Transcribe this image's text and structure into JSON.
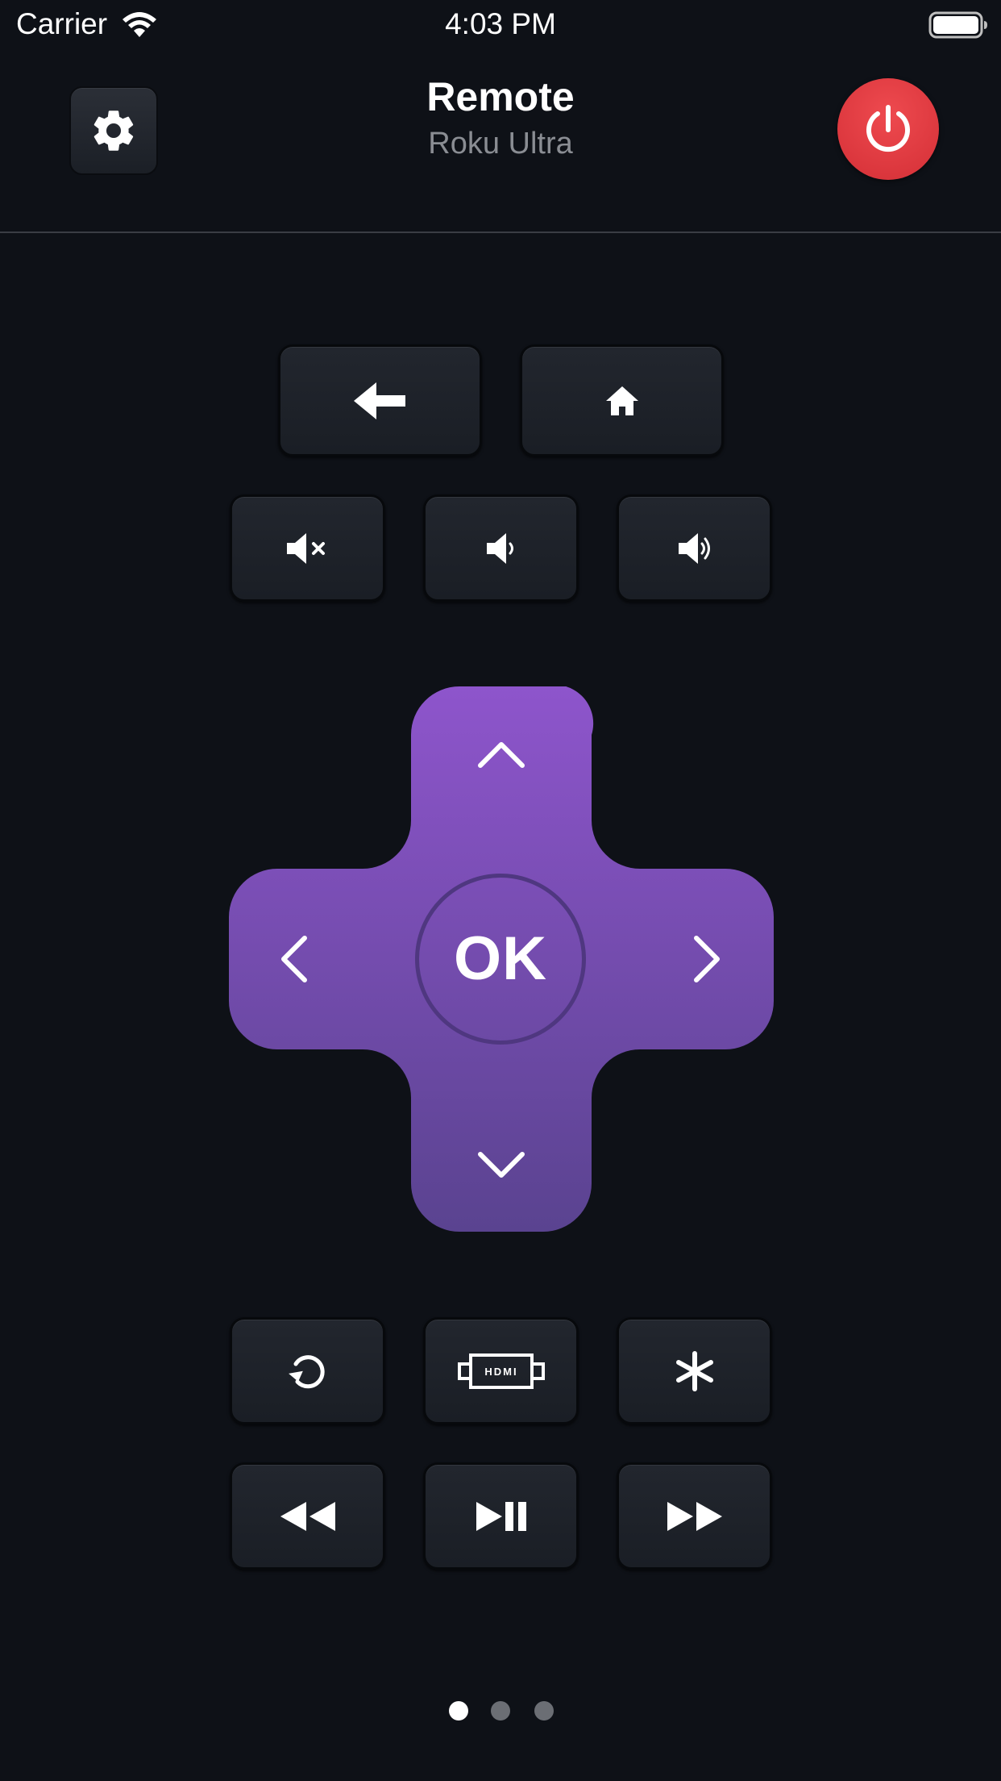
{
  "status_bar": {
    "carrier": "Carrier",
    "time": "4:03 PM",
    "icons": [
      "wifi-icon",
      "battery-icon"
    ]
  },
  "header": {
    "title": "Remote",
    "subtitle": "Roku Ultra",
    "settings_icon": "gear-icon",
    "power_icon": "power-icon"
  },
  "buttons": {
    "row1": [
      "back-arrow-icon",
      "home-icon"
    ],
    "row2": [
      "mute-icon",
      "volume-down-icon",
      "volume-up-icon"
    ],
    "dpad": {
      "up": "chevron-up-icon",
      "down": "chevron-down-icon",
      "left": "chevron-left-icon",
      "right": "chevron-right-icon",
      "ok_label": "OK"
    },
    "row3": [
      "replay-icon",
      "hdmi-icon",
      "asterisk-icon"
    ],
    "hdmi_label": "HDMI",
    "row4": [
      "rewind-icon",
      "play-pause-icon",
      "fast-forward-icon"
    ]
  },
  "pager": {
    "page_count": 3,
    "current_page": 1
  },
  "colors": {
    "background": "#0e1117",
    "accent_purple_top": "#8e55cc",
    "accent_purple_bottom": "#5a4390",
    "power_red": "#e0393f",
    "key_surface": "#1f232b",
    "subtitle_gray": "#8a8d93"
  }
}
